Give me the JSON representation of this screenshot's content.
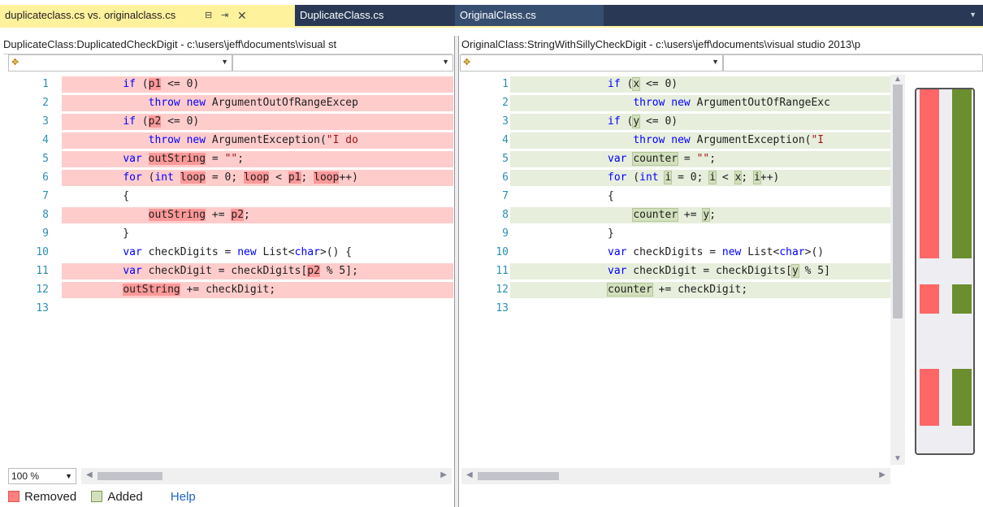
{
  "tabs": [
    {
      "label": "duplicateclass.cs vs. originalclass.cs",
      "pin_icon": "pin-icon",
      "close_icon": "close-icon"
    },
    {
      "label": "DuplicateClass.cs"
    },
    {
      "label": "OriginalClass.cs"
    }
  ],
  "icons": {
    "lock": "⊟",
    "pin": "⇥",
    "close": "✕",
    "dropdown": "▼",
    "class_icon": "✥",
    "up": "▲",
    "down": "▼",
    "left": "◀",
    "right": "▶"
  },
  "left_pane": {
    "path": "DuplicateClass:DuplicatedCheckDigit - c:\\users\\jeff\\documents\\visual st",
    "lines": [
      {
        "n": "1"
      },
      {
        "n": "2"
      },
      {
        "n": "3"
      },
      {
        "n": "4"
      },
      {
        "n": "5"
      },
      {
        "n": "6"
      },
      {
        "n": "7"
      },
      {
        "n": "8"
      },
      {
        "n": "9"
      },
      {
        "n": "10"
      },
      {
        "n": "11"
      },
      {
        "n": "12"
      },
      {
        "n": "13"
      }
    ]
  },
  "right_pane": {
    "path": "OriginalClass:StringWithSillyCheckDigit - c:\\users\\jeff\\documents\\visual studio 2013\\p",
    "lines": [
      {
        "n": "1"
      },
      {
        "n": "2"
      },
      {
        "n": "3"
      },
      {
        "n": "4"
      },
      {
        "n": "5"
      },
      {
        "n": "6"
      },
      {
        "n": "7"
      },
      {
        "n": "8"
      },
      {
        "n": "9"
      },
      {
        "n": "10"
      },
      {
        "n": "11"
      },
      {
        "n": "12"
      },
      {
        "n": "13"
      }
    ]
  },
  "zoom": "100 %",
  "legend": {
    "removed": "Removed",
    "added": "Added",
    "help": "Help"
  },
  "colors": {
    "removed_bg": "#ffcccc",
    "removed_hl": "#ff9999",
    "added_bg": "#e7eedc",
    "added_hl": "#d3e0bd",
    "overview_removed": "#ff6666",
    "overview_added": "#6b8e2f",
    "tab_active": "#fff29d"
  }
}
